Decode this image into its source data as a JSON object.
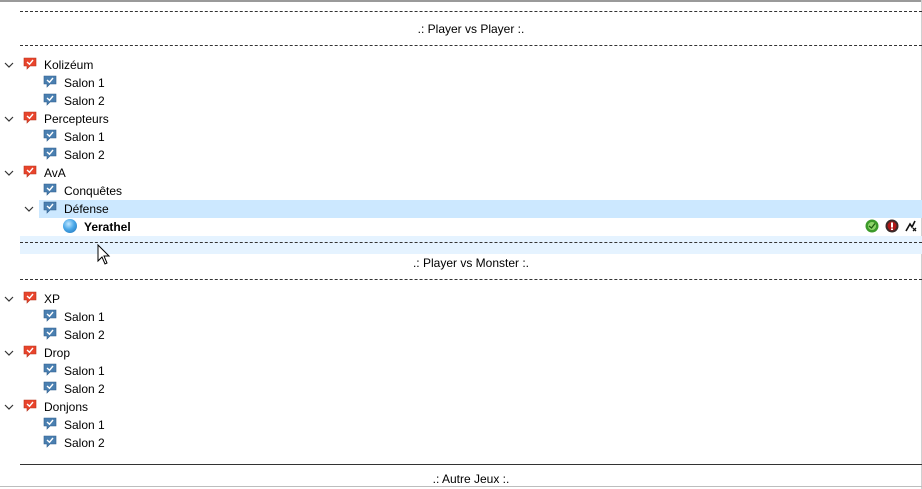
{
  "sections": [
    {
      "title": ".: Player vs Player :."
    },
    {
      "title": ".: Player vs Monster :."
    },
    {
      "title": ".: Autre Jeux :."
    }
  ],
  "pvp": {
    "kolizeum": {
      "label": "Kolizéum",
      "children": [
        "Salon 1",
        "Salon 2"
      ]
    },
    "percepteurs": {
      "label": "Percepteurs",
      "children": [
        "Salon 1",
        "Salon 2"
      ]
    },
    "ava": {
      "label": "AvA",
      "conquetes": "Conquêtes",
      "defense": "Défense",
      "user": "Yerathel"
    }
  },
  "pvm": {
    "xp": {
      "label": "XP",
      "children": [
        "Salon 1",
        "Salon 2"
      ]
    },
    "drop": {
      "label": "Drop",
      "children": [
        "Salon 1",
        "Salon 2"
      ]
    },
    "donjons": {
      "label": "Donjons",
      "children": [
        "Salon 1",
        "Salon 2"
      ]
    }
  },
  "colors": {
    "selected": "#cce8ff",
    "hover": "#e5f3ff",
    "channel_red": "#e8442c",
    "channel_blue": "#4a7fb0"
  },
  "icons": {
    "expand": "chevron-down-icon",
    "channel_group": "red-channel-icon",
    "channel": "blue-channel-icon",
    "user": "user-ball-icon",
    "badges": [
      "recording-icon",
      "muted-icon",
      "away-icon"
    ]
  }
}
